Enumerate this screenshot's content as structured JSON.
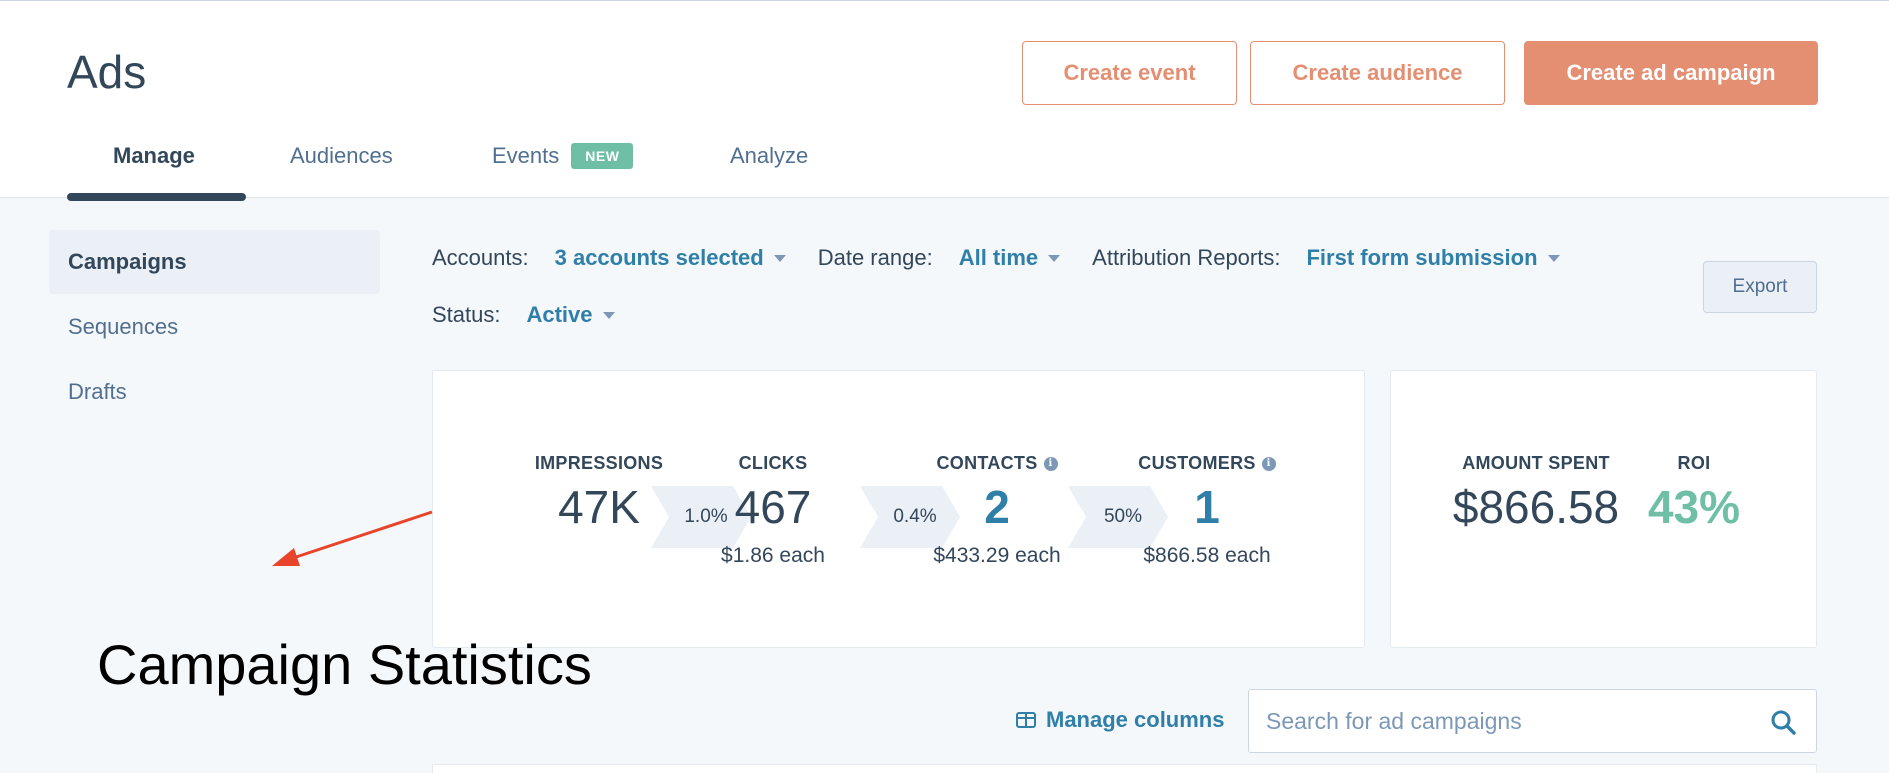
{
  "header": {
    "title": "Ads",
    "buttons": {
      "create_event": "Create event",
      "create_audience": "Create audience",
      "create_ad_campaign": "Create ad campaign"
    },
    "tabs": [
      {
        "label": "Manage"
      },
      {
        "label": "Audiences"
      },
      {
        "label": "Events",
        "badge": "NEW"
      },
      {
        "label": "Analyze"
      }
    ]
  },
  "sidebar": {
    "items": [
      {
        "label": "Campaigns"
      },
      {
        "label": "Sequences"
      },
      {
        "label": "Drafts"
      }
    ]
  },
  "filters": {
    "accounts_label": "Accounts:",
    "accounts_value": "3 accounts selected",
    "date_range_label": "Date range:",
    "date_range_value": "All time",
    "attribution_label": "Attribution Reports:",
    "attribution_value": "First form submission",
    "status_label": "Status:",
    "status_value": "Active"
  },
  "export_label": "Export",
  "funnel": {
    "impressions": {
      "label": "IMPRESSIONS",
      "value": "47K"
    },
    "rate_1": "1.0%",
    "clicks": {
      "label": "CLICKS",
      "value": "467",
      "sub": "$1.86 each"
    },
    "rate_2": "0.4%",
    "contacts": {
      "label": "CONTACTS",
      "value": "2",
      "sub": "$433.29 each"
    },
    "rate_3": "50%",
    "customers": {
      "label": "CUSTOMERS",
      "value": "1",
      "sub": "$866.58 each"
    }
  },
  "spend": {
    "amount_spent": {
      "label": "AMOUNT SPENT",
      "value": "$866.58"
    },
    "roi": {
      "label": "ROI",
      "value": "43%"
    }
  },
  "manage_columns_label": "Manage columns",
  "search": {
    "placeholder": "Search for ad campaigns",
    "value": ""
  },
  "annotation": {
    "text": "Campaign Statistics"
  },
  "colors": {
    "accent_orange": "#e48e72",
    "link_blue": "#2f7fa8",
    "roi_green": "#6ebfa6",
    "annotation_arrow": "#e8442c"
  }
}
